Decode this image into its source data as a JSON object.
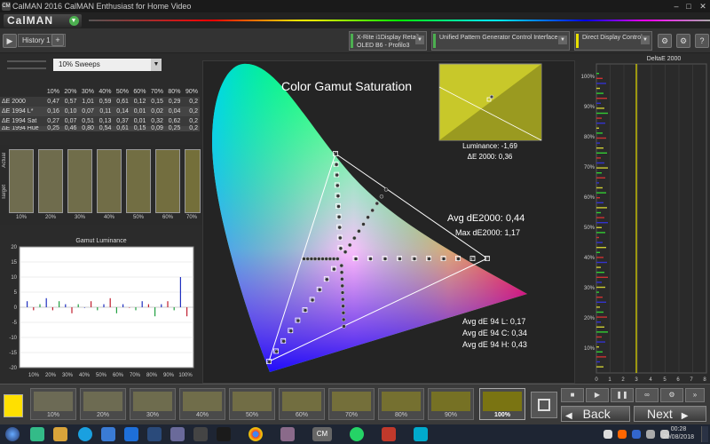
{
  "window": {
    "title": "CalMAN 2016 CalMAN Enthusiast for Home Video",
    "logo_icon": "CM",
    "logo_text": "CalMAN"
  },
  "toolbar": {
    "history_tab": "History 1",
    "devices": [
      {
        "line1": "X-Rite i1Display Retail",
        "line2": "OLED B6 - Profilo3",
        "color": "#4caf50"
      },
      {
        "line1": "Unified Pattern Generator Control Interface",
        "line2": "",
        "color": "#4caf50"
      },
      {
        "line1": "Direct Display Control",
        "line2": "",
        "color": "#e8e000"
      }
    ]
  },
  "sweep": {
    "selected": "10% Sweeps"
  },
  "table": {
    "headers": [
      "",
      "10%",
      "20%",
      "30%",
      "40%",
      "50%",
      "60%",
      "70%",
      "80%",
      "90%"
    ],
    "rows": [
      {
        "label": "ΔE 2000",
        "values": [
          "0,47",
          "0,57",
          "1,01",
          "0,59",
          "0,61",
          "0,12",
          "0,15",
          "0,29",
          "0,2"
        ]
      },
      {
        "label": "ΔE 1994 L*",
        "values": [
          "0,16",
          "0,10",
          "0,07",
          "0,11",
          "0,14",
          "0,01",
          "0,02",
          "0,04",
          "0,2"
        ]
      },
      {
        "label": "ΔE 1994 Sat",
        "values": [
          "0,27",
          "0,07",
          "0,51",
          "0,13",
          "0,37",
          "0,01",
          "0,32",
          "0,62",
          "0,2"
        ]
      },
      {
        "label": "ΔE 1994 Hue",
        "values": [
          "0,25",
          "0,46",
          "0,80",
          "0,54",
          "0,61",
          "0,15",
          "0,09",
          "0,25",
          "0,2"
        ]
      }
    ]
  },
  "swatches": {
    "actual_label": "Actual",
    "target_label": "Target",
    "labels": [
      "10%",
      "20%",
      "30%",
      "40%",
      "50%",
      "60%",
      "70%"
    ]
  },
  "luminance_chart": {
    "title": "Gamut Luminance",
    "y_ticks": [
      "20",
      "15",
      "10",
      "5",
      "0",
      "-5",
      "-10",
      "-15",
      "-20"
    ],
    "x_ticks": [
      "10%",
      "20%",
      "30%",
      "40%",
      "50%",
      "60%",
      "70%",
      "80%",
      "90%",
      "100%"
    ]
  },
  "gamut": {
    "title": "Color Gamut Saturation",
    "avg_de2000": "Avg dE2000: 0,44",
    "max_de2000": "Max dE2000: 1,17",
    "luminance": "Luminance: -1,69",
    "de2000_point": "ΔE 2000: 0,36",
    "avg_l": "Avg dE 94 L: 0,17",
    "avg_c": "Avg dE 94 C: 0,34",
    "avg_h": "Avg dE 94 H: 0,43"
  },
  "de_chart": {
    "title": "DeltaE 2000",
    "y_ticks": [
      "100%",
      "90%",
      "80%",
      "70%",
      "60%",
      "50%",
      "40%",
      "30%",
      "20%",
      "10%"
    ],
    "x_ticks": [
      "0",
      "1",
      "2",
      "3",
      "4",
      "5",
      "6",
      "7",
      "8"
    ]
  },
  "bottom": {
    "swatch_labels": [
      "10%",
      "20%",
      "30%",
      "40%",
      "50%",
      "60%",
      "70%",
      "80%",
      "90%",
      "100%"
    ],
    "back": "Back",
    "next": "Next"
  },
  "clock": {
    "time": "00:28",
    "date": "20/08/2018"
  }
}
